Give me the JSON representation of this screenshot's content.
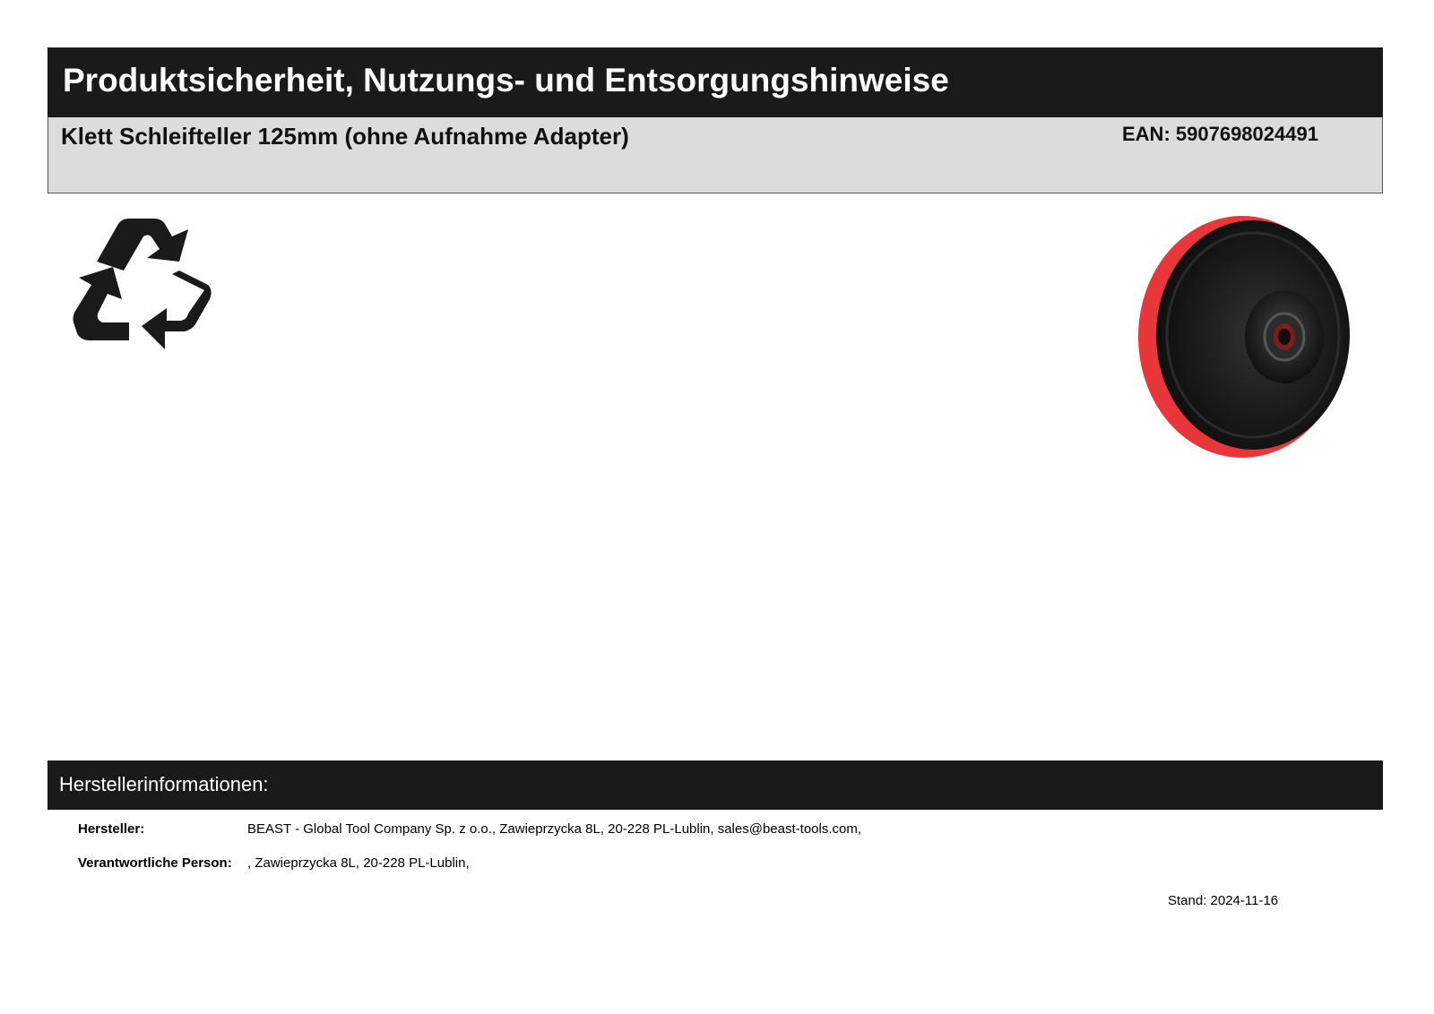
{
  "header": {
    "title": "Produktsicherheit, Nutzungs- und Entsorgungshinweise"
  },
  "product": {
    "name": "Klett Schleifteller 125mm (ohne Aufnahme Adapter)",
    "ean": "EAN: 5907698024491",
    "image_icon": "sanding-pad-image"
  },
  "symbols": {
    "recycle_icon": "recycle-icon"
  },
  "manufacturer_section": {
    "title": "Herstellerinformationen:",
    "rows": [
      {
        "label": "Hersteller:",
        "value": "BEAST - Global Tool Company Sp. z o.o., Zawieprzycka 8L, 20-228 PL-Lublin, sales@beast-tools.com,"
      },
      {
        "label": "Verantwortliche Person:",
        "value": ", Zawieprzycka 8L, 20-228 PL-Lublin,"
      }
    ]
  },
  "stand": "Stand: 2024-11-16",
  "colors": {
    "header_bg": "#1a1a1a",
    "product_box_bg": "#dcdcdc",
    "pad_red": "#e8373a",
    "pad_black": "#151515"
  }
}
